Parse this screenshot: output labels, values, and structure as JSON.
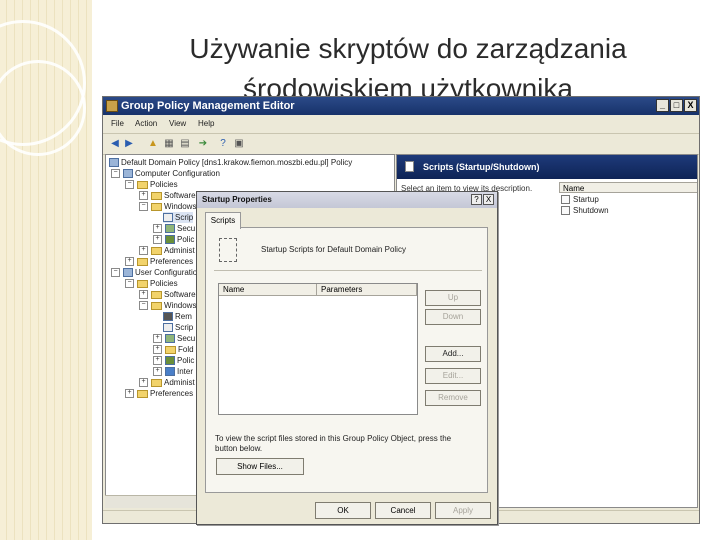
{
  "slide": {
    "title_line1": "Używanie skryptów do zarządzania",
    "title_line2": "środowiskiem użytkownika"
  },
  "window": {
    "title": "Group Policy Management Editor",
    "controls": [
      "_",
      "□",
      "X"
    ],
    "menu": [
      "File",
      "Action",
      "View",
      "Help"
    ]
  },
  "tree": {
    "items": [
      {
        "label": "Default Domain Policy [dns1.krakow.fiemon.moszbi.edu.pl] Policy",
        "expander": "",
        "icon": "gpo"
      },
      {
        "label": "Computer Configuration",
        "expander": "−",
        "icon": "computer"
      },
      {
        "label": "Policies",
        "expander": "−",
        "icon": "folder"
      },
      {
        "label": "Software",
        "expander": "+",
        "icon": "folder"
      },
      {
        "label": "Windows",
        "expander": "−",
        "icon": "folder"
      },
      {
        "label": "Scrip",
        "expander": "",
        "icon": "script"
      },
      {
        "label": "Secu",
        "expander": "+",
        "icon": "security"
      },
      {
        "label": "Polic",
        "expander": "+",
        "icon": "chart"
      },
      {
        "label": "Administ",
        "expander": "+",
        "icon": "folder"
      },
      {
        "label": "Preferences",
        "expander": "+",
        "icon": "folder"
      },
      {
        "label": "User Configuration",
        "expander": "−",
        "icon": "user"
      },
      {
        "label": "Policies",
        "expander": "−",
        "icon": "folder"
      },
      {
        "label": "Software",
        "expander": "+",
        "icon": "folder"
      },
      {
        "label": "Windows",
        "expander": "−",
        "icon": "folder"
      },
      {
        "label": "Rem",
        "expander": "",
        "icon": "remote"
      },
      {
        "label": "Scrip",
        "expander": "",
        "icon": "script"
      },
      {
        "label": "Secu",
        "expander": "+",
        "icon": "security"
      },
      {
        "label": "Fold",
        "expander": "+",
        "icon": "folder"
      },
      {
        "label": "Polic",
        "expander": "+",
        "icon": "chart"
      },
      {
        "label": "Inter",
        "expander": "+",
        "icon": "internet"
      },
      {
        "label": "Administ",
        "expander": "+",
        "icon": "folder"
      },
      {
        "label": "Preferences",
        "expander": "+",
        "icon": "folder"
      }
    ]
  },
  "details": {
    "header": "Scripts (Startup/Shutdown)",
    "description": "Select an item to view its description.",
    "column": "Name",
    "items": [
      "Startup",
      "Shutdown"
    ]
  },
  "dialog": {
    "title": "Startup Properties",
    "help": "?",
    "close": "X",
    "tab": "Scripts",
    "panel_title": "Startup Scripts for Default Domain Policy",
    "columns": [
      "Name",
      "Parameters"
    ],
    "side_buttons": [
      "Up",
      "Down",
      "Add...",
      "Edit...",
      "Remove"
    ],
    "hint": "To view the script files stored in this Group Policy Object, press the button below.",
    "show_files": "Show Files...",
    "ok": "OK",
    "cancel": "Cancel",
    "apply": "Apply"
  }
}
